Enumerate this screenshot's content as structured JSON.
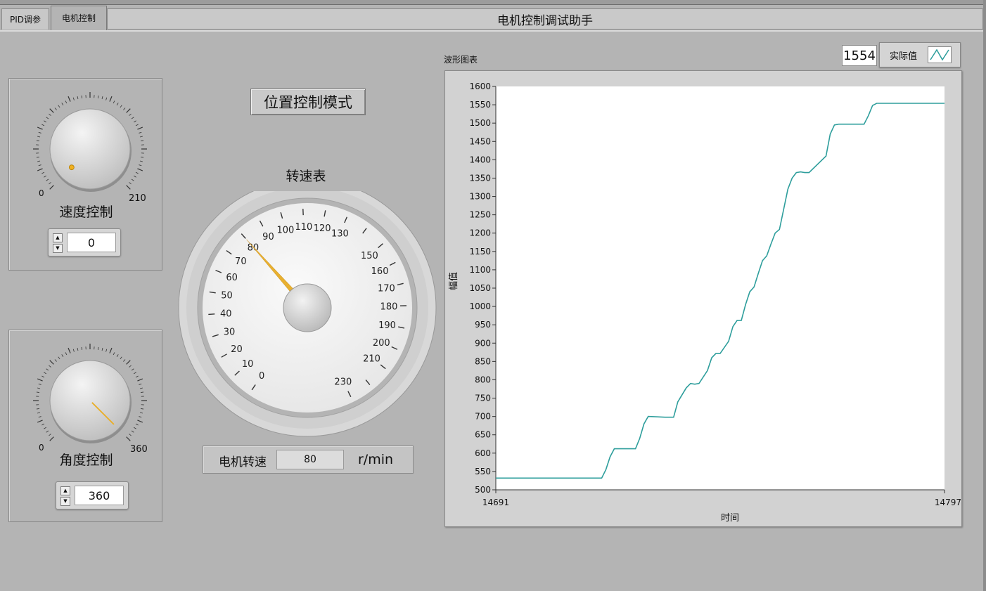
{
  "window": {
    "title": "电机控制调试助手"
  },
  "tabs": [
    {
      "label": "PID调参",
      "active": false
    },
    {
      "label": "电机控制",
      "active": true
    }
  ],
  "speed_knob": {
    "label": "速度控制",
    "min": "0",
    "max": "210",
    "value": "0",
    "numeric_value": 0,
    "min_value": 0,
    "max_value": 210
  },
  "angle_knob": {
    "label": "角度控制",
    "min": "0",
    "max": "360",
    "value": "360",
    "numeric_value": 360,
    "min_value": 0,
    "max_value": 360
  },
  "mode_button": {
    "label": "位置控制模式"
  },
  "gauge": {
    "title": "转速表",
    "value": 80,
    "tick_labels": [
      "0",
      "10",
      "20",
      "30",
      "40",
      "50",
      "60",
      "70",
      "80",
      "90",
      "100",
      "110",
      "120",
      "130",
      "150",
      "160",
      "170",
      "180",
      "190",
      "200",
      "210",
      "230"
    ]
  },
  "motor_speed": {
    "label": "电机转速",
    "value": "80",
    "unit": "r/min"
  },
  "chart": {
    "title": "波形图表",
    "legend_value": "1554",
    "legend_label": "实际值"
  },
  "colors": {
    "background": "#b4b4b4",
    "trace": "#2e9e9c",
    "needle": "#e8b030",
    "knob_dot": "#f0b020"
  },
  "icons": {
    "spin_up": "triangle-up-icon",
    "spin_down": "triangle-down-icon",
    "legend": "line-plot-icon"
  },
  "chart_data": {
    "type": "line",
    "title": "",
    "xlabel": "时间",
    "ylabel": "幅值",
    "xlim": [
      14691,
      14797
    ],
    "ylim": [
      500,
      1600
    ],
    "x_tick_labels": [
      "14691",
      "14797"
    ],
    "y_ticks": [
      "500",
      "550",
      "600",
      "650",
      "700",
      "750",
      "800",
      "850",
      "900",
      "950",
      "1000",
      "1050",
      "1100",
      "1150",
      "1200",
      "1250",
      "1300",
      "1350",
      "1400",
      "1450",
      "1500",
      "1550",
      "1600"
    ],
    "grid": false,
    "series": [
      {
        "name": "实际值",
        "x": [
          14691,
          14716,
          14717,
          14718,
          14719,
          14724,
          14725,
          14726,
          14727,
          14731,
          14732,
          14733,
          14734,
          14736,
          14737,
          14738,
          14739,
          14741,
          14742,
          14743,
          14744,
          14746,
          14747,
          14748,
          14749,
          14750,
          14751,
          14752,
          14753,
          14754,
          14755,
          14756,
          14757,
          14758,
          14759,
          14760,
          14761,
          14762,
          14763,
          14764,
          14765,
          14769,
          14770,
          14771,
          14772,
          14778,
          14779,
          14780,
          14781,
          14797
        ],
        "y": [
          532,
          532,
          555,
          590,
          612,
          612,
          640,
          680,
          700,
          698,
          698,
          698,
          740,
          778,
          790,
          788,
          790,
          825,
          860,
          872,
          872,
          905,
          945,
          962,
          962,
          1005,
          1040,
          1053,
          1090,
          1125,
          1138,
          1170,
          1200,
          1210,
          1265,
          1320,
          1350,
          1365,
          1367,
          1365,
          1365,
          1410,
          1470,
          1495,
          1497,
          1497,
          1520,
          1548,
          1554,
          1554
        ]
      }
    ]
  }
}
